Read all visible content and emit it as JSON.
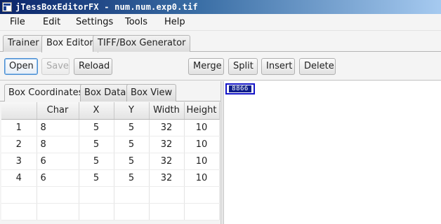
{
  "window": {
    "title": "jTessBoxEditorFX - num.num.exp0.tif"
  },
  "menubar": {
    "items": [
      "File",
      "Edit",
      "Settings",
      "Tools",
      "Help"
    ]
  },
  "main_tabs": [
    "Trainer",
    "Box Editor",
    "TIFF/Box Generator"
  ],
  "main_tabs_selected": "Box Editor",
  "toolbar": {
    "open": "Open",
    "save": "Save",
    "reload": "Reload",
    "merge": "Merge",
    "split": "Split",
    "insert": "Insert",
    "delete": "Delete"
  },
  "sub_tabs": [
    "Box Coordinates",
    "Box Data",
    "Box View"
  ],
  "sub_tabs_selected": "Box Coordinates",
  "table": {
    "columns": [
      "",
      "Char",
      "X",
      "Y",
      "Width",
      "Height"
    ],
    "rows": [
      [
        "1",
        "8",
        "5",
        "5",
        "32",
        "10"
      ],
      [
        "2",
        "8",
        "5",
        "5",
        "32",
        "10"
      ],
      [
        "3",
        "6",
        "5",
        "5",
        "32",
        "10"
      ],
      [
        "4",
        "6",
        "5",
        "5",
        "32",
        "10"
      ]
    ]
  },
  "image_pane": {
    "glyph_text": "8866"
  },
  "colors": {
    "box_outline": "#1414c8",
    "glyph_fill": "#0e1e8a",
    "focus_ring": "#4a8ed2"
  }
}
